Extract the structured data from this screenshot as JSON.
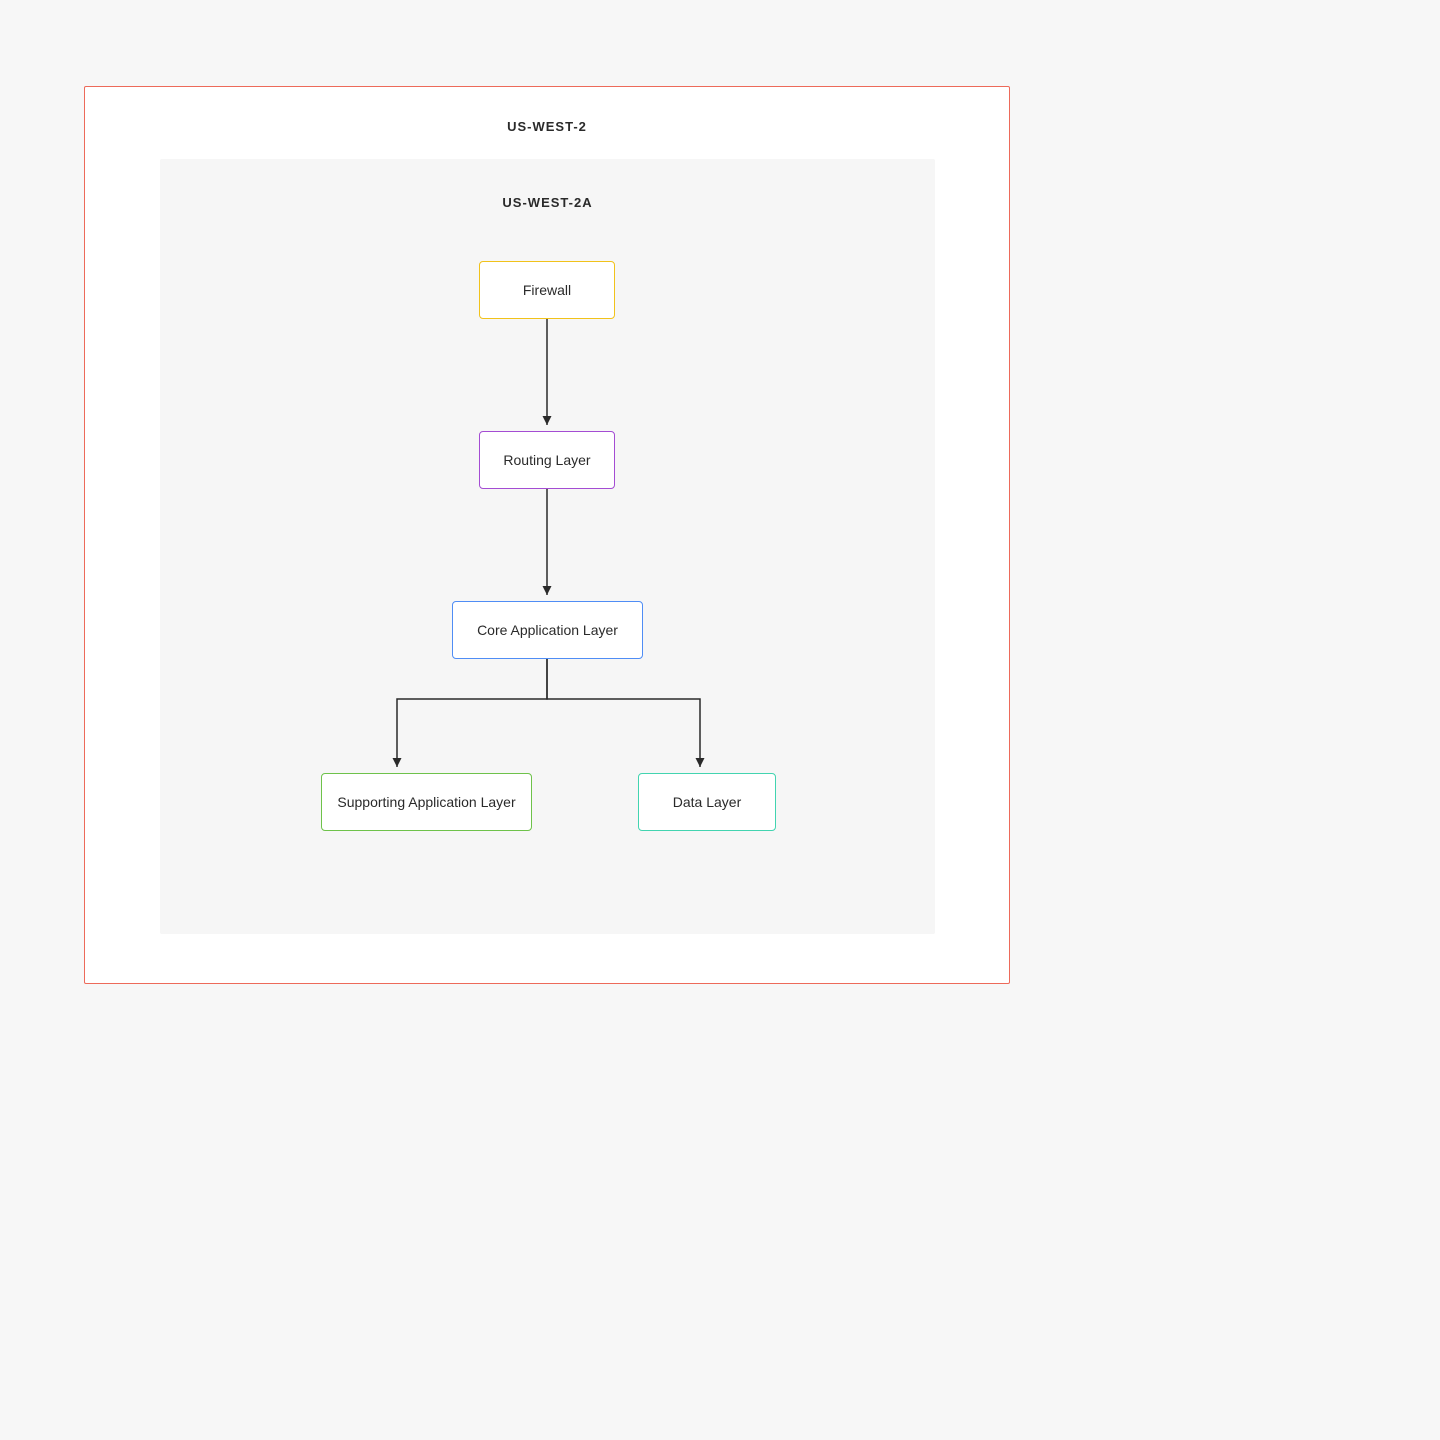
{
  "region": {
    "title": "US-WEST-2"
  },
  "availability_zone": {
    "title": "US-WEST-2A"
  },
  "nodes": {
    "firewall": {
      "label": "Firewall",
      "border_color": "#f1c21b"
    },
    "routing": {
      "label": "Routing Layer",
      "border_color": "#a44cd3"
    },
    "core": {
      "label": "Core Application Layer",
      "border_color": "#4f8df5"
    },
    "supporting": {
      "label": "Supporting Application Layer",
      "border_color": "#6ec24a"
    },
    "data": {
      "label": "Data Layer",
      "border_color": "#42d4b0"
    }
  },
  "edges": [
    {
      "from": "firewall",
      "to": "routing"
    },
    {
      "from": "routing",
      "to": "core"
    },
    {
      "from": "core",
      "to": "supporting"
    },
    {
      "from": "core",
      "to": "data"
    }
  ]
}
